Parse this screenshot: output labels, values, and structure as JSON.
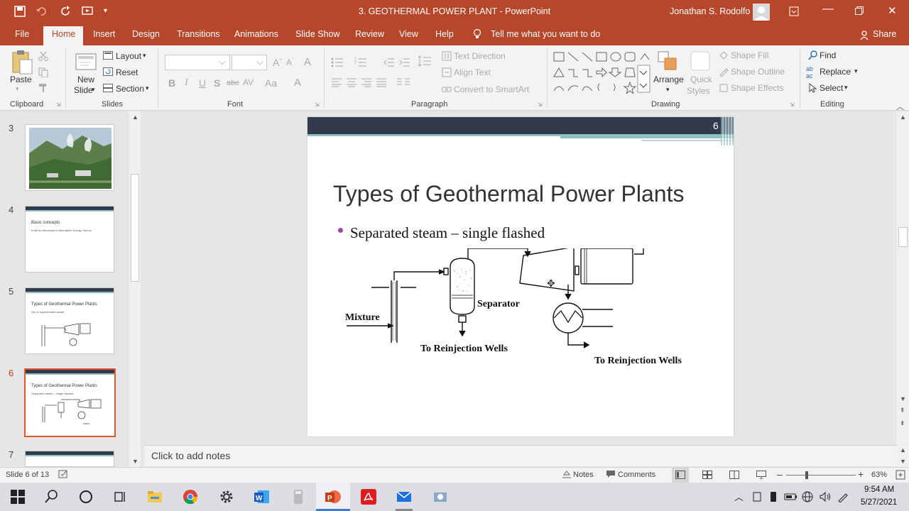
{
  "titlebar": {
    "title": "3. GEOTHERMAL POWER PLANT  -  PowerPoint",
    "user": "Jonathan S. Rodolfo"
  },
  "tabs": [
    "File",
    "Home",
    "Insert",
    "Design",
    "Transitions",
    "Animations",
    "Slide Show",
    "Review",
    "View",
    "Help"
  ],
  "tell_me": "Tell me what you want to do",
  "share": "Share",
  "ribbon": {
    "clipboard": {
      "paste": "Paste",
      "group": "Clipboard"
    },
    "slides": {
      "new_slide": "New",
      "new_slide2": "Slide",
      "layout": "Layout",
      "reset": "Reset",
      "section": "Section",
      "group": "Slides"
    },
    "font": {
      "group": "Font",
      "bold": "B",
      "italic": "I",
      "underline": "U",
      "shadow": "S",
      "strike": "abc",
      "spacing": "AV",
      "case": "Aa",
      "clear": "A"
    },
    "paragraph": {
      "text_direction": "Text Direction",
      "align_text": "Align Text",
      "convert": "Convert to SmartArt",
      "group": "Paragraph"
    },
    "drawing": {
      "arrange": "Arrange",
      "quick_styles": "Quick",
      "quick_styles2": "Styles",
      "shape_fill": "Shape Fill",
      "shape_outline": "Shape Outline",
      "shape_effects": "Shape Effects",
      "group": "Drawing"
    },
    "editing": {
      "find": "Find",
      "replace": "Replace",
      "select": "Select",
      "group": "Editing"
    }
  },
  "thumbnails": [
    {
      "num": "3"
    },
    {
      "num": "4",
      "title": "Basic concepts",
      "bullet": "It will be discussed in Alternative Energy Source"
    },
    {
      "num": "5",
      "title": "Types of Geothermal Power Plants",
      "bullet": "Dry or superheated steam"
    },
    {
      "num": "6",
      "title": "Types of Geothermal Power Plants",
      "bullet": "Separated steam – single flashed"
    },
    {
      "num": "7"
    }
  ],
  "slide": {
    "number": "6",
    "title": "Types of Geothermal Power Plants",
    "bullet": "Separated steam – single flashed",
    "diagram": {
      "mixture": "Mixture",
      "separator": "Separator",
      "reinjection1": "To Reinjection Wells",
      "reinjection2": "To Reinjection Wells"
    }
  },
  "notes_placeholder": "Click to add notes",
  "status": {
    "slide_info": "Slide 6 of 13",
    "notes": "Notes",
    "comments": "Comments",
    "zoom": "63%"
  },
  "clock": {
    "time": "9:54 AM",
    "date": "5/27/2021"
  },
  "colors": {
    "accent": "#b7472a",
    "slide_header": "#323b4d",
    "teal": "#8fbfbe",
    "bullet_dot": "#9b4b9c",
    "selected_thumb": "#e0582e"
  }
}
